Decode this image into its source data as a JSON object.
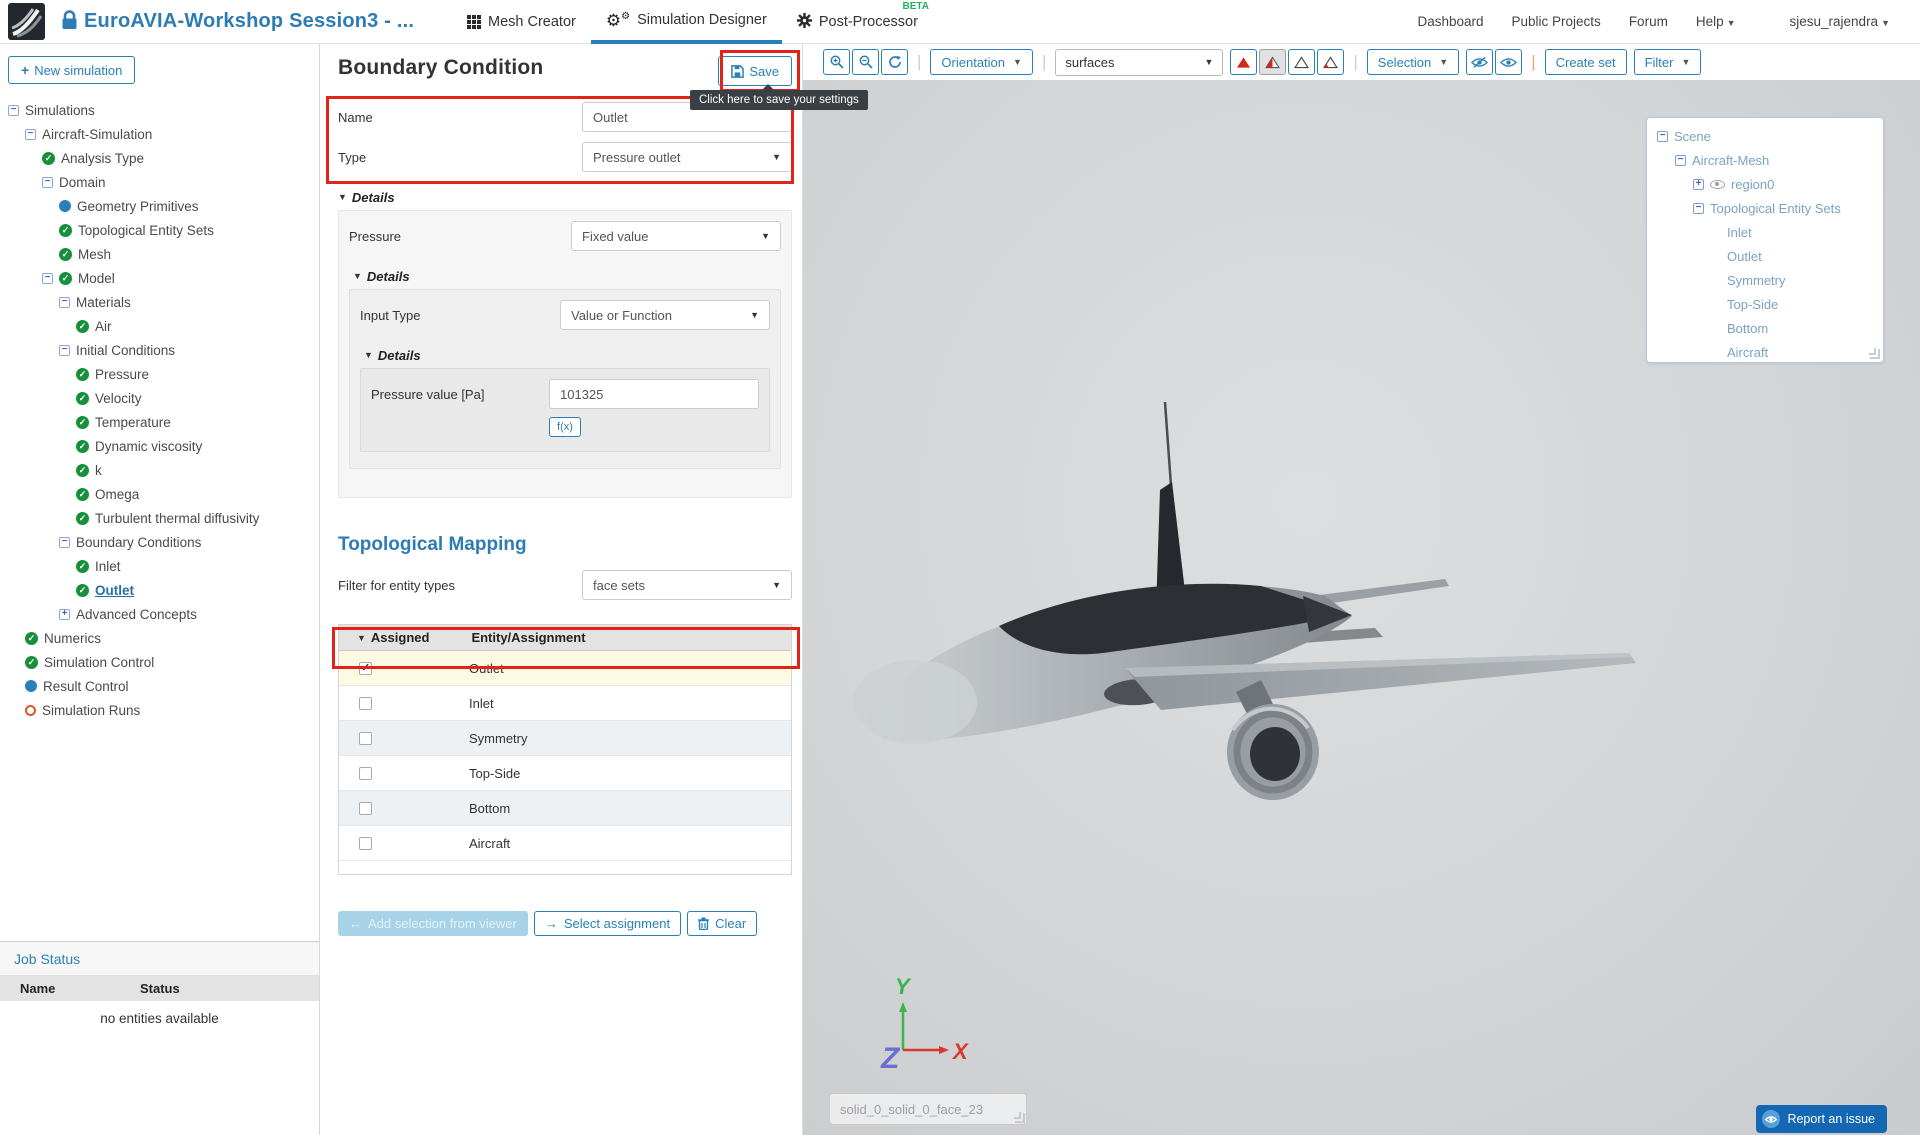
{
  "colors": {
    "accent": "#2980b9",
    "annotation_red": "#e02419",
    "check_green": "#17903c",
    "beta_green": "#27ae60",
    "runs_orange": "#e0552c",
    "highlight_yellow": "#fcfae3",
    "viewer_bg": "#d4d6d8"
  },
  "topbar": {
    "title": "EuroAVIA-Workshop Session3 - ...",
    "tabs": [
      {
        "label": "Mesh Creator"
      },
      {
        "label": "Simulation Designer"
      },
      {
        "label": "Post-Processor",
        "beta": "BETA"
      }
    ],
    "nav": [
      "Dashboard",
      "Public Projects",
      "Forum",
      "Help"
    ],
    "user": "sjesu_rajendra"
  },
  "sidebar": {
    "new_simulation": "New simulation",
    "tree": [
      {
        "label": "Simulations",
        "level": 0,
        "icons": [
          "minus"
        ]
      },
      {
        "label": "Aircraft-Simulation",
        "level": 1,
        "icons": [
          "minus"
        ]
      },
      {
        "label": "Analysis Type",
        "level": 2,
        "icons": [
          "check"
        ]
      },
      {
        "label": "Domain",
        "level": 2,
        "icons": [
          "minus"
        ]
      },
      {
        "label": "Geometry Primitives",
        "level": 3,
        "icons": [
          "dot"
        ]
      },
      {
        "label": "Topological Entity Sets",
        "level": 3,
        "icons": [
          "check"
        ]
      },
      {
        "label": "Mesh",
        "level": 3,
        "icons": [
          "check"
        ]
      },
      {
        "label": "Model",
        "level": 2,
        "icons": [
          "minus",
          "check"
        ]
      },
      {
        "label": "Materials",
        "level": 3,
        "icons": [
          "minus"
        ]
      },
      {
        "label": "Air",
        "level": 4,
        "icons": [
          "check"
        ]
      },
      {
        "label": "Initial Conditions",
        "level": 3,
        "icons": [
          "minus"
        ]
      },
      {
        "label": "Pressure",
        "level": 4,
        "icons": [
          "check"
        ]
      },
      {
        "label": "Velocity",
        "level": 4,
        "icons": [
          "check"
        ]
      },
      {
        "label": "Temperature",
        "level": 4,
        "icons": [
          "check"
        ]
      },
      {
        "label": "Dynamic viscosity",
        "level": 4,
        "icons": [
          "check"
        ]
      },
      {
        "label": "k",
        "level": 4,
        "icons": [
          "check"
        ]
      },
      {
        "label": "Omega",
        "level": 4,
        "icons": [
          "check"
        ]
      },
      {
        "label": "Turbulent thermal diffusivity",
        "level": 4,
        "icons": [
          "check"
        ]
      },
      {
        "label": "Boundary Conditions",
        "level": 3,
        "icons": [
          "minus"
        ]
      },
      {
        "label": "Inlet",
        "level": 4,
        "icons": [
          "check"
        ]
      },
      {
        "label": "Outlet",
        "level": 4,
        "icons": [
          "check"
        ],
        "selected": true
      },
      {
        "label": "Advanced Concepts",
        "level": 3,
        "icons": [
          "plus"
        ]
      },
      {
        "label": "Numerics",
        "level": 1,
        "icons": [
          "check"
        ]
      },
      {
        "label": "Simulation Control",
        "level": 1,
        "icons": [
          "check"
        ]
      },
      {
        "label": "Result Control",
        "level": 1,
        "icons": [
          "dot"
        ]
      },
      {
        "label": "Simulation Runs",
        "level": 1,
        "icons": [
          "circle"
        ]
      }
    ],
    "job_status": {
      "title": "Job Status",
      "name_col": "Name",
      "status_col": "Status",
      "empty": "no entities available"
    }
  },
  "panel": {
    "title": "Boundary Condition",
    "save": "Save",
    "tooltip": "Click here to save your settings",
    "name_label": "Name",
    "name_value": "Outlet",
    "type_label": "Type",
    "type_value": "Pressure outlet",
    "details_label": "Details",
    "pressure_label": "Pressure",
    "pressure_select": "Fixed value",
    "input_type_label": "Input Type",
    "input_type_value": "Value or Function",
    "pressure_value_label": "Pressure value [Pa]",
    "pressure_value": "101325",
    "fx_label": "f(x)",
    "topo_title": "Topological Mapping",
    "filter_label": "Filter for entity types",
    "filter_value": "face sets",
    "table": {
      "assigned_col": "Assigned",
      "entity_col": "Entity/Assignment",
      "rows": [
        {
          "label": "Outlet",
          "checked": true,
          "highlight": true
        },
        {
          "label": "Inlet"
        },
        {
          "label": "Symmetry"
        },
        {
          "label": "Top-Side"
        },
        {
          "label": "Bottom"
        },
        {
          "label": "Aircraft"
        }
      ]
    },
    "buttons": {
      "add": "Add selection from viewer",
      "select": "Select assignment",
      "clear": "Clear"
    }
  },
  "viewer": {
    "toolbar": {
      "orientation": "Orientation",
      "surfaces": "surfaces",
      "selection": "Selection",
      "create_set": "Create set",
      "filter": "Filter"
    },
    "scene_tree": [
      {
        "label": "Scene",
        "level": 0,
        "icons": [
          "minus"
        ]
      },
      {
        "label": "Aircraft-Mesh",
        "level": 1,
        "icons": [
          "minus"
        ]
      },
      {
        "label": "region0",
        "level": 2,
        "icons": [
          "plus",
          "eye"
        ]
      },
      {
        "label": "Topological Entity Sets",
        "level": 2,
        "icons": [
          "minus"
        ]
      },
      {
        "label": "Inlet",
        "level": 3,
        "icons": []
      },
      {
        "label": "Outlet",
        "level": 3,
        "icons": []
      },
      {
        "label": "Symmetry",
        "level": 3,
        "icons": []
      },
      {
        "label": "Top-Side",
        "level": 3,
        "icons": []
      },
      {
        "label": "Bottom",
        "level": 3,
        "icons": []
      },
      {
        "label": "Aircraft",
        "level": 3,
        "icons": []
      }
    ],
    "axis": {
      "x": "X",
      "y": "Y",
      "z": "Z"
    },
    "face_label": "solid_0_solid_0_face_23",
    "report": "Report an issue"
  }
}
